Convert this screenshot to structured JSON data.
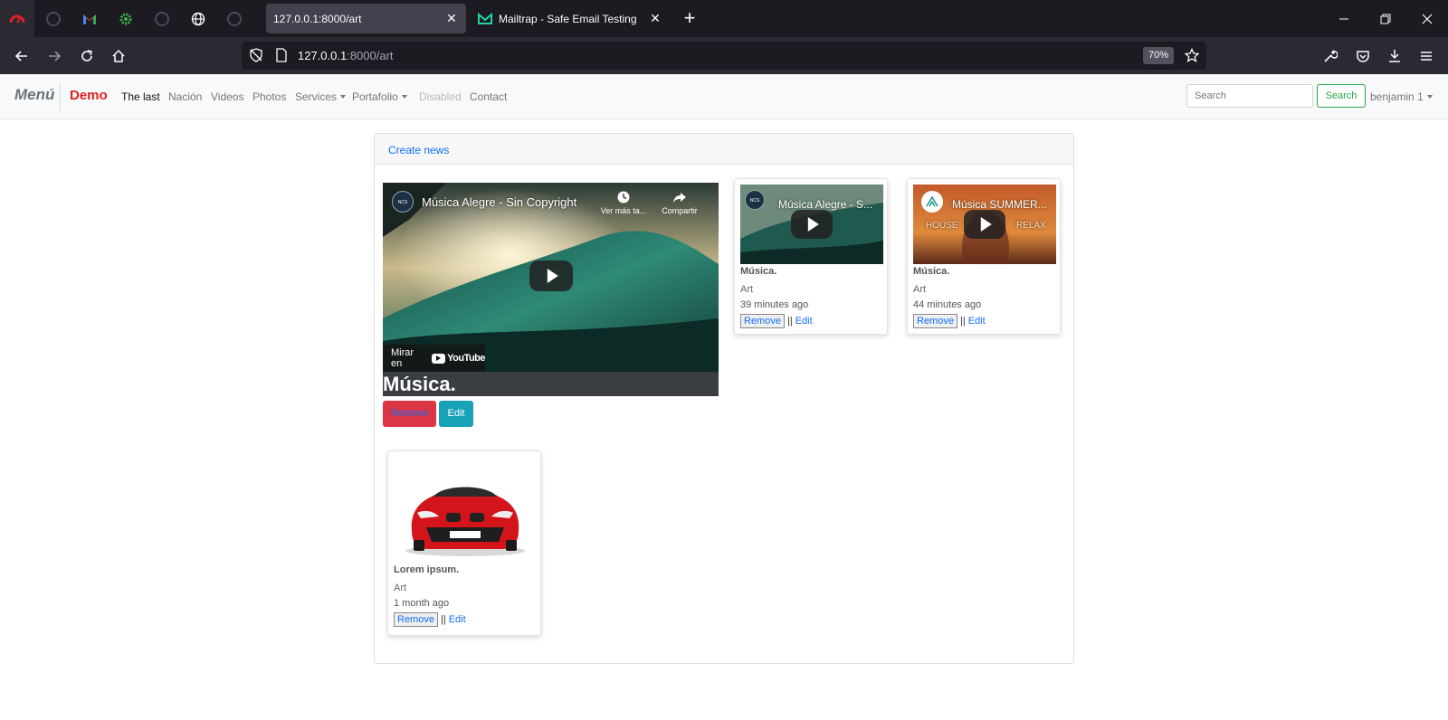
{
  "browser": {
    "active_tab_title": "127.0.0.1:8000/art",
    "inactive_tab_title": "Mailtrap - Safe Email Testing",
    "url_host": "127.0.0.1",
    "url_path": ":8000/art",
    "zoom": "70%"
  },
  "site": {
    "brand": "Menú",
    "demo": "Demo",
    "nav": [
      "The last",
      "Nación",
      "Videos",
      "Photos",
      "Services",
      "Portafolio",
      "Disabled",
      "Contact"
    ],
    "search_placeholder": "Search",
    "search_button": "Search",
    "user": "benjamin 1"
  },
  "content": {
    "create_link": "Create news",
    "featured": {
      "video_title": "Música Alegre - Sin Copyright",
      "watch_later": "Ver más ta...",
      "share": "Compartir",
      "watch_on": "Mirar en",
      "youtube": "YouTube",
      "title": "Música.",
      "remove": "Remove",
      "edit": "Edit"
    },
    "cards": [
      {
        "video_title": "Música Alegre - S...",
        "title": "Música.",
        "category": "Art",
        "time": "39 minutes ago",
        "remove": "Remove",
        "sep": "||",
        "edit": "Edit"
      },
      {
        "video_title": "Música SUMMER...",
        "overlay_left": "HOUSE",
        "overlay_right": "RELAX",
        "title": "Música.",
        "category": "Art",
        "time": "44 minutes ago",
        "remove": "Remove",
        "sep": "||",
        "edit": "Edit"
      },
      {
        "title": "Lorem ipsum.",
        "category": "Art",
        "time": "1 month ago",
        "remove": "Remove",
        "sep": "||",
        "edit": "Edit"
      }
    ]
  }
}
